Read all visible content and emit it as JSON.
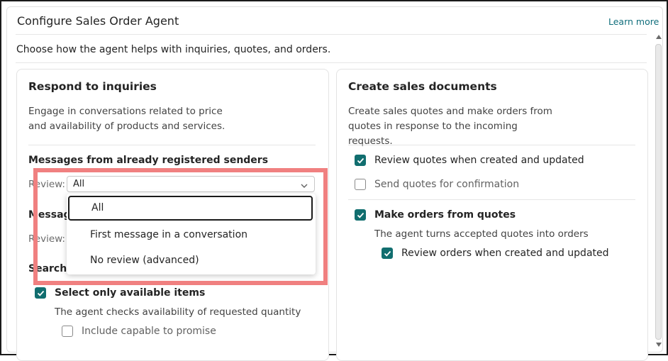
{
  "header": {
    "title": "Configure Sales Order Agent",
    "learn_more": "Learn more"
  },
  "description": "Choose how the agent helps with inquiries, quotes, and orders.",
  "left_card": {
    "title": "Respond to inquiries",
    "desc": "Engage in conversations related to price and availability of products and services.",
    "registered_senders": {
      "heading": "Messages from already registered senders",
      "review_label": "Review:",
      "review_value": "All",
      "options": [
        "All",
        "First message in a conversation",
        "No review (advanced)"
      ],
      "selected_index": 0
    },
    "unknown_senders": {
      "heading_visible": "Message",
      "review_label": "Review:"
    },
    "search": {
      "heading_visible": "Search f",
      "select_available": {
        "label": "Select only available items",
        "checked": true
      },
      "select_available_desc": "The agent checks availability of requested quantity",
      "capable_to_promise": {
        "label": "Include capable to promise",
        "checked": false
      }
    }
  },
  "right_card": {
    "title": "Create sales documents",
    "desc": "Create sales quotes and make orders from quotes in response to the incoming requests.",
    "review_quotes": {
      "label": "Review quotes when created and updated",
      "checked": true
    },
    "send_quotes": {
      "label": "Send quotes for confirmation",
      "checked": false
    },
    "make_orders": {
      "label": "Make orders from quotes",
      "checked": true
    },
    "make_orders_desc": "The agent turns accepted quotes into orders",
    "review_orders": {
      "label": "Review orders when created and updated",
      "checked": true
    }
  },
  "colors": {
    "accent": "#116e6f",
    "highlight": "#f08080",
    "link": "#106e7c"
  },
  "icons": {
    "check": "check-icon",
    "chevron": "chevron-down-icon"
  }
}
